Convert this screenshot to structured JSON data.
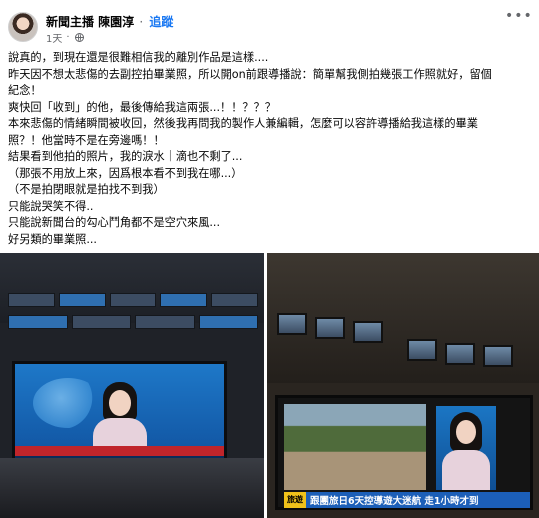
{
  "post": {
    "author": "新聞主播 陳園淳",
    "separator": "·",
    "follow_label": "追蹤",
    "time": "1天",
    "audience_icon": "globe-icon",
    "more_icon": "more-options-icon",
    "lines": [
      "說真的，到現在還是很難相信我的離別作品是這樣....",
      "昨天因不想太悲傷的去副控拍畢業照，所以開on前跟導播說：簡單幫我側拍幾張工作照就好，留個",
      "紀念！",
      "爽快回「收到」的他，最後傳給我這兩張...！！？？？",
      "本來悲傷的情緒瞬間被收回，然後我再問我的製作人兼編輯，怎麼可以容許導播給我這樣的畢業",
      "照？！他當時不是在旁邊嗎！！",
      "結果看到他拍的照片，我的淚水｜滴也不剩了...",
      "（那張不用放上來，因爲根本看不到我在哪...）",
      "（不是拍閉眼就是拍找不到我）",
      "只能說哭笑不得..",
      "只能說新聞台的勾心鬥角都不是空穴來風...",
      "好另類的畢業照..."
    ]
  },
  "photos": {
    "right_headline_tag": "旅遊",
    "right_headline": "跟團旅日6天控導遊大迷航 走1小時才到"
  },
  "colors": {
    "link": "#1877f2",
    "secondary_text": "#65676b",
    "primary_text": "#050505"
  }
}
